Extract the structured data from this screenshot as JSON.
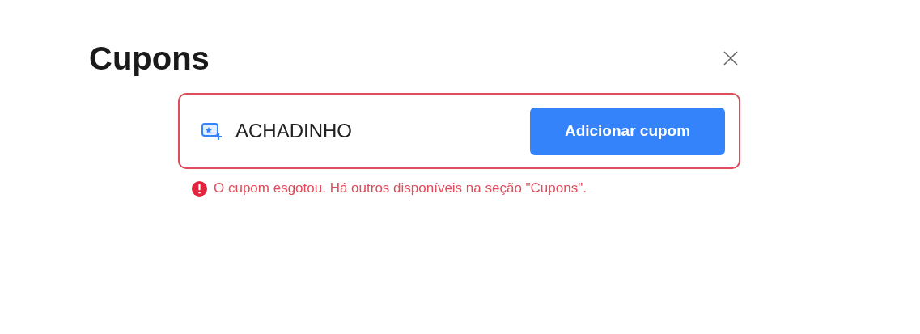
{
  "title": "Cupons",
  "coupon_field": {
    "value": "ACHADINHO",
    "error": true
  },
  "add_button": "Adicionar cupom",
  "error_message": "O cupom esgotou. Há outros disponíveis na seção \"Cupons\"."
}
